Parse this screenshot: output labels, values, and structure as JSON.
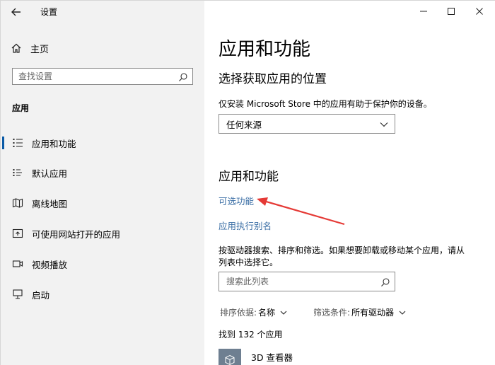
{
  "window": {
    "title": "设置"
  },
  "sidebar": {
    "home_label": "主页",
    "search_placeholder": "查找设置",
    "section_label": "应用",
    "items": [
      {
        "label": "应用和功能",
        "icon": "apps-list-icon",
        "active": true
      },
      {
        "label": "默认应用",
        "icon": "default-apps-icon"
      },
      {
        "label": "离线地图",
        "icon": "offline-map-icon"
      },
      {
        "label": "可使用网站打开的应用",
        "icon": "website-apps-icon"
      },
      {
        "label": "视频播放",
        "icon": "video-playback-icon"
      },
      {
        "label": "启动",
        "icon": "startup-icon"
      }
    ],
    "active_color": "#0a5aa6"
  },
  "main": {
    "title": "应用和功能",
    "location_heading": "选择获取应用的位置",
    "location_desc": "仅安装 Microsoft Store 中的应用有助于保护你的设备。",
    "source_selected": "任何来源",
    "apps_heading": "应用和功能",
    "optional_features_link": "可选功能",
    "app_alias_link": "应用执行别名",
    "search_desc_line1": "按驱动器搜索、排序和筛选。如果想要卸载或移动某个应用，请从",
    "search_desc_line2": "列表中选择它。",
    "app_search_placeholder": "搜索此列表",
    "sort_key": "排序依据:",
    "sort_value": "名称",
    "filter_key": "筛选条件:",
    "filter_value": "所有驱动器",
    "count_text": "找到 132 个应用",
    "first_app": "3D 查看器",
    "link_color": "#3a6ea5",
    "annotation_arrow_color": "#e53935"
  }
}
